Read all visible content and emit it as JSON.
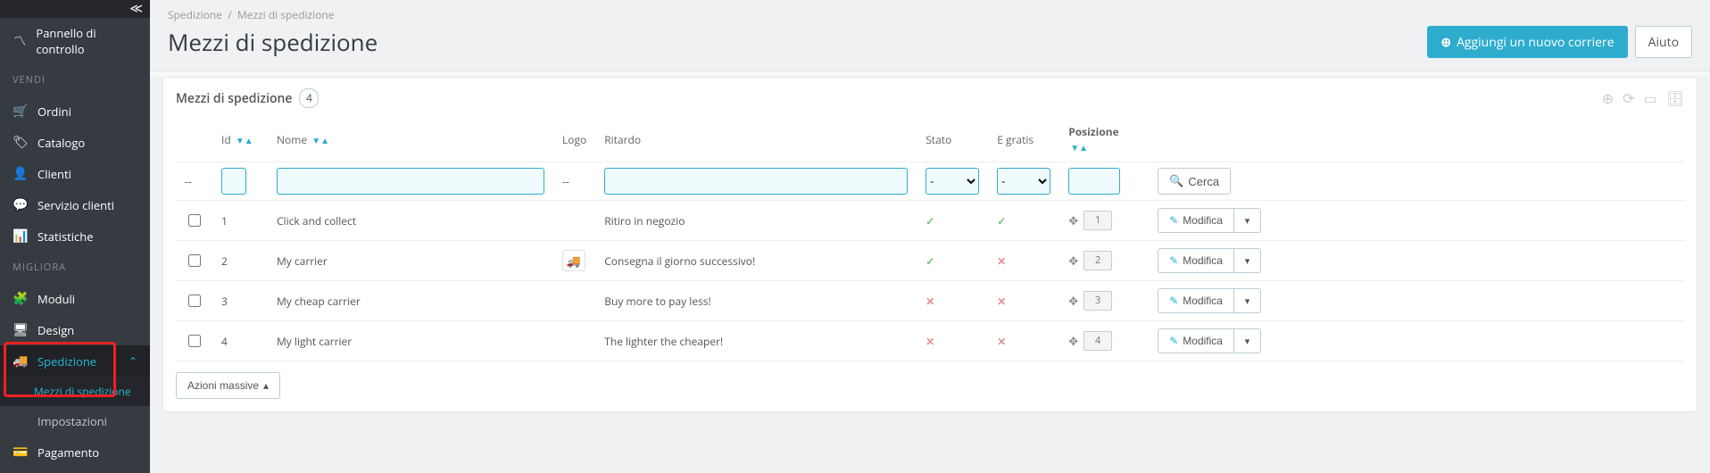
{
  "sidebar": {
    "dashboard": {
      "icon": "pulse",
      "label": "Pannello di controllo"
    },
    "section_sell": "VENDI",
    "sell": [
      {
        "icon": "cart",
        "label": "Ordini"
      },
      {
        "icon": "tag",
        "label": "Catalogo"
      },
      {
        "icon": "user",
        "label": "Clienti"
      },
      {
        "icon": "chat",
        "label": "Servizio clienti"
      },
      {
        "icon": "bar",
        "label": "Statistiche"
      }
    ],
    "section_improve": "MIGLIORA",
    "improve": [
      {
        "icon": "puzzle",
        "label": "Moduli"
      },
      {
        "icon": "monitor",
        "label": "Design"
      },
      {
        "icon": "truck",
        "label": "Spedizione",
        "active": true,
        "open": true
      },
      {
        "icon": "gear",
        "label": "Impostazioni"
      },
      {
        "icon": "card",
        "label": "Pagamento"
      }
    ],
    "spedizione_sub": [
      {
        "label": "Mezzi di spedizione",
        "active": true
      }
    ]
  },
  "breadcrumb": {
    "root": "Spedizione",
    "sep": "/",
    "current": "Mezzi di spedizione"
  },
  "page": {
    "title": "Mezzi di spedizione",
    "add_label": "Aggiungi un nuovo corriere",
    "help_label": "Aiuto"
  },
  "panel": {
    "title": "Mezzi di spedizione",
    "count": "4"
  },
  "columns": {
    "id": "Id",
    "name": "Nome",
    "logo": "Logo",
    "delay": "Ritardo",
    "status": "Stato",
    "free": "E gratis",
    "position": "Posizione"
  },
  "filters": {
    "dash": "--",
    "select_placeholder": "-",
    "search_label": "Cerca"
  },
  "rows": [
    {
      "id": "1",
      "name": "Click and collect",
      "has_logo": false,
      "delay": "Ritiro in negozio",
      "status": true,
      "free": true,
      "position": "1"
    },
    {
      "id": "2",
      "name": "My carrier",
      "has_logo": true,
      "delay": "Consegna il giorno successivo!",
      "status": true,
      "free": false,
      "position": "2"
    },
    {
      "id": "3",
      "name": "My cheap carrier",
      "has_logo": false,
      "delay": "Buy more to pay less!",
      "status": false,
      "free": false,
      "position": "3"
    },
    {
      "id": "4",
      "name": "My light carrier",
      "has_logo": false,
      "delay": "The lighter the cheaper!",
      "status": false,
      "free": false,
      "position": "4"
    }
  ],
  "actions": {
    "edit": "Modifica"
  },
  "bulk": {
    "label": "Azioni massive"
  }
}
